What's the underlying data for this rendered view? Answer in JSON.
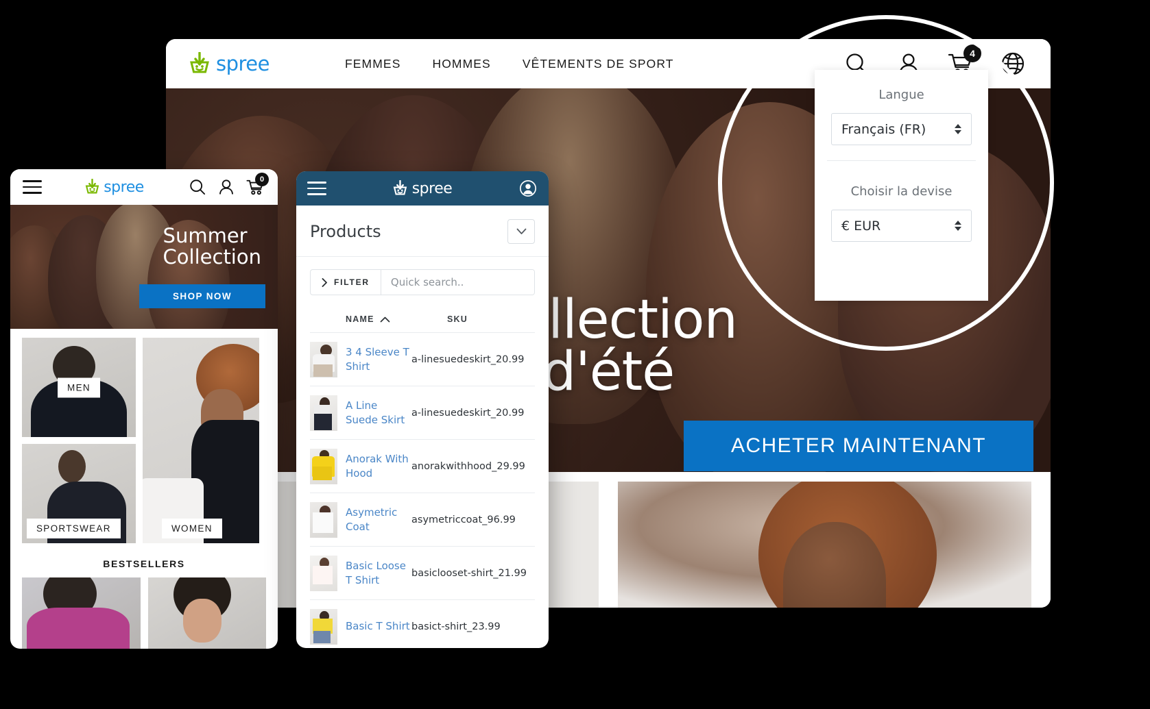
{
  "desktop": {
    "brand": "spree",
    "nav": [
      "FEMMES",
      "HOMMES",
      "VÊTEMENTS DE SPORT"
    ],
    "icons": {
      "search": "search-icon",
      "account": "user-icon",
      "cart": "cart-icon",
      "globe": "globe-icon"
    },
    "cart_count": "4",
    "hero": {
      "title_line1": "Collection",
      "title_line2": "d'été",
      "cta": "ACHETER MAINTENANT"
    }
  },
  "lang_panel": {
    "language_label": "Langue",
    "language_value": "Français (FR)",
    "currency_label": "Choisir la devise",
    "currency_value": "€ EUR"
  },
  "mobile": {
    "brand": "spree",
    "cart_count": "0",
    "hero": {
      "title_line1": "Summer",
      "title_line2": "Collection",
      "cta": "SHOP NOW"
    },
    "tiles": [
      {
        "label": "MEN"
      },
      {
        "label": "SPORTSWEAR"
      },
      {
        "label": "WOMEN"
      }
    ],
    "bestsellers_heading": "BESTSELLERS"
  },
  "admin": {
    "brand": "spree",
    "page_title": "Products",
    "filter_label": "FILTER",
    "search_placeholder": "Quick search..",
    "columns": [
      "NAME",
      "SKU"
    ],
    "sort_column": "NAME",
    "sort_direction": "asc",
    "rows": [
      {
        "name": "3 4 Sleeve T Shirt",
        "sku": "a-linesuedeskirt_20.99"
      },
      {
        "name": "A Line Suede Skirt",
        "sku": "a-linesuedeskirt_20.99"
      },
      {
        "name": "Anorak With Hood",
        "sku": "anorakwithhood_29.99"
      },
      {
        "name": "Asymetric Coat",
        "sku": "asymetriccoat_96.99"
      },
      {
        "name": "Basic Loose T Shirt",
        "sku": "basiclooset-shirt_21.99"
      },
      {
        "name": "Basic T Shirt",
        "sku": "basict-shirt_23.99"
      }
    ]
  },
  "colors": {
    "brand_blue": "#1e8fe1",
    "brand_green": "#7ab800",
    "cta_blue": "#0a72c4",
    "admin_navy": "#20506f",
    "link_blue": "#4a86c7"
  }
}
